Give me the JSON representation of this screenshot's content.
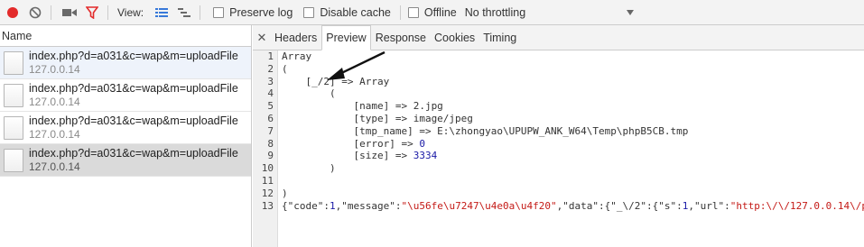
{
  "toolbar": {
    "view_label": "View:",
    "preserve_log": "Preserve log",
    "disable_cache": "Disable cache",
    "offline": "Offline",
    "throttling": "No throttling"
  },
  "list": {
    "header": "Name",
    "rows": [
      {
        "name": "index.php?d=a031&c=wap&m=uploadFile",
        "host": "127.0.0.14"
      },
      {
        "name": "index.php?d=a031&c=wap&m=uploadFile",
        "host": "127.0.0.14"
      },
      {
        "name": "index.php?d=a031&c=wap&m=uploadFile",
        "host": "127.0.0.14"
      },
      {
        "name": "index.php?d=a031&c=wap&m=uploadFile",
        "host": "127.0.0.14"
      }
    ]
  },
  "tabs": [
    "Headers",
    "Preview",
    "Response",
    "Cookies",
    "Timing"
  ],
  "active_tab": "Preview",
  "code": {
    "line_numbers": [
      "1",
      "2",
      "3",
      "4",
      "5",
      "6",
      "7",
      "8",
      "9",
      "10",
      "11",
      "12",
      "13"
    ],
    "l1": "Array",
    "l2": "(",
    "l3": "    [_/2] => Array",
    "l4": "        (",
    "l5": "            [name] => 2.jpg",
    "l6": "            [type] => image/jpeg",
    "l7": "            [tmp_name] => E:\\zhongyao\\UPUPW_ANK_W64\\Temp\\phpB5CB.tmp",
    "l8_prefix": "            [error] => ",
    "l8_value": "0",
    "l9_prefix": "            [size] => ",
    "l9_value": "3334",
    "l10": "        )",
    "l11": "",
    "l12": ")",
    "l13": {
      "p1": "{\"code\":",
      "v1": "1",
      "p2": ",\"message\":",
      "v2": "\"\\u56fe\\u7247\\u4e0a\\u4f20\"",
      "p3": ",\"data\":{\"_\\/2\":{\"s\":",
      "v3": "1",
      "p4": ",\"url\":",
      "v4": "\"http:\\/\\/127.0.0.14\\/p"
    }
  },
  "colors": {
    "record": "#e32b2b",
    "filter": "#e32b2b",
    "accent": "#3879d9"
  }
}
